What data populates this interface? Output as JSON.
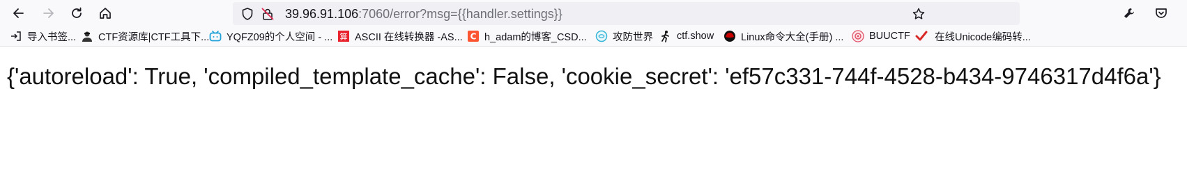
{
  "browser": {
    "url_host": "39.96.91.106",
    "url_rest": ":7060/error?msg={{handler.settings}}"
  },
  "bookmarks": [
    {
      "label": "导入书签...",
      "icon": "import-icon"
    },
    {
      "label": "CTF资源库|CTF工具下...",
      "icon": "hacker-icon"
    },
    {
      "label": "YQFZ09的个人空间 - ...",
      "icon": "bilibili-icon"
    },
    {
      "label": "ASCII 在线转换器 -AS...",
      "icon": "calc-icon"
    },
    {
      "label": "h_adam的博客_CSD...",
      "icon": "csdn-icon"
    },
    {
      "label": "攻防世界",
      "icon": "globe-icon"
    },
    {
      "label": "ctf.show",
      "icon": "runner-icon"
    },
    {
      "label": "Linux命令大全(手册) ...",
      "icon": "redhat-icon"
    },
    {
      "label": "BUUCTF",
      "icon": "buuctf-icon"
    },
    {
      "label": "在线Unicode编码转...",
      "icon": "check-icon"
    }
  ],
  "page": {
    "content": "{'autoreload': True, 'compiled_template_cache': False, 'cookie_secret': 'ef57c331-744f-4528-b434-9746317d4f6a'}"
  },
  "colors": {
    "csdn": "#fc5531",
    "calc": "#e8232d",
    "redhat": "#cc0000",
    "bilibili": "#20a1d8",
    "check": "#d92a2a"
  }
}
